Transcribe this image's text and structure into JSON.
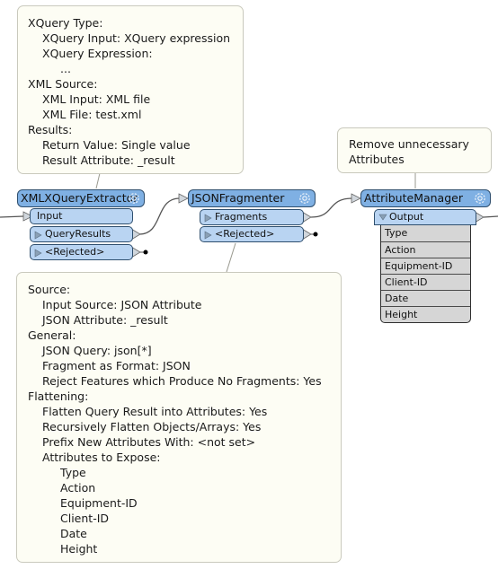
{
  "annotations": {
    "xquery": {
      "lines": [
        {
          "text": "XQuery Type:",
          "indent": 0
        },
        {
          "text": "XQuery Input: XQuery expression",
          "indent": 1
        },
        {
          "text": "XQuery Expression:",
          "indent": 1
        },
        {
          "text": "...",
          "indent": 2
        },
        {
          "text": "XML Source:",
          "indent": 0
        },
        {
          "text": "XML Input: XML file",
          "indent": 1
        },
        {
          "text": "XML File: test.xml",
          "indent": 1
        },
        {
          "text": "Results:",
          "indent": 0
        },
        {
          "text": "Return Value: Single value",
          "indent": 1
        },
        {
          "text": "Result Attribute: _result",
          "indent": 1
        }
      ]
    },
    "attrmanager": {
      "lines": [
        {
          "text": "Remove unnecessary",
          "indent": 0
        },
        {
          "text": "Attributes",
          "indent": 0
        }
      ]
    },
    "jsonfrag": {
      "lines": [
        {
          "text": "Source:",
          "indent": 0
        },
        {
          "text": "Input Source: JSON Attribute",
          "indent": 1
        },
        {
          "text": "JSON Attribute: _result",
          "indent": 1
        },
        {
          "text": "General:",
          "indent": 0
        },
        {
          "text": "JSON Query: json[*]",
          "indent": 1
        },
        {
          "text": "Fragment as Format: JSON",
          "indent": 1
        },
        {
          "text": "Reject Features which Produce No Fragments: Yes",
          "indent": 1
        },
        {
          "text": "Flattening:",
          "indent": 0
        },
        {
          "text": "Flatten Query Result into Attributes: Yes",
          "indent": 1
        },
        {
          "text": "Recursively Flatten Objects/Arrays: Yes",
          "indent": 1
        },
        {
          "text": "Prefix New Attributes With: <not set>",
          "indent": 1
        },
        {
          "text": "Attributes to Expose:",
          "indent": 1
        },
        {
          "text": "Type",
          "indent": 3
        },
        {
          "text": "Action",
          "indent": 3
        },
        {
          "text": "Equipment-ID",
          "indent": 3
        },
        {
          "text": "Client-ID",
          "indent": 3
        },
        {
          "text": "Date",
          "indent": 3
        },
        {
          "text": "Height",
          "indent": 3
        }
      ]
    }
  },
  "transformers": {
    "xmlxquery": {
      "name": "XMLXQueryExtractor",
      "input_port": "Input",
      "output_ports": [
        "QueryResults",
        "<Rejected>"
      ]
    },
    "jsonfragmenter": {
      "name": "JSONFragmenter",
      "output_ports": [
        "Fragments",
        "<Rejected>"
      ]
    },
    "attributemanager": {
      "name": "AttributeManager",
      "output_port": "Output",
      "attributes": [
        "Type",
        "Action",
        "Equipment-ID",
        "Client-ID",
        "Date",
        "Height"
      ]
    }
  },
  "colors": {
    "transformer_fill": "#7fb0e3",
    "port_fill": "#b9d4f2",
    "annotation_fill": "#fdfdf4",
    "attribute_list_fill": "#d6d6d6",
    "connection_line": "#555555"
  }
}
